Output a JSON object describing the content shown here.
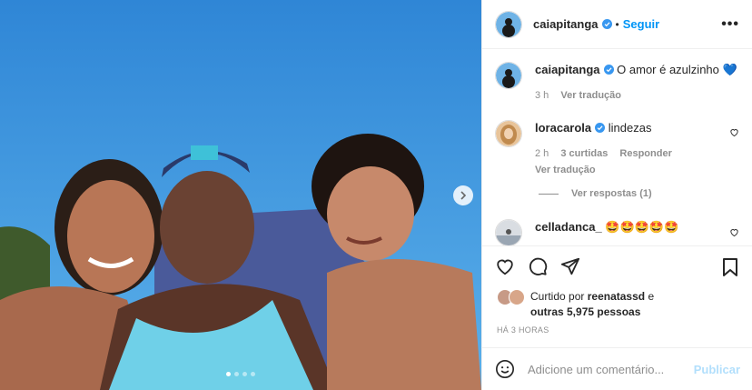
{
  "post": {
    "image_alt": "Selfie de três mulheres na praia",
    "carousel": {
      "slides": 4,
      "active": 0
    }
  },
  "header": {
    "username": "caiapitanga",
    "separator": "•",
    "follow_label": "Seguir",
    "more_icon": "more-horizontal-icon"
  },
  "caption": {
    "username": "caiapitanga",
    "text": "O amor é azulzinho 💙",
    "time": "3 h",
    "translate": "Ver tradução"
  },
  "comments": [
    {
      "username": "loracarola",
      "text": "lindezas",
      "time": "2 h",
      "likes": "3 curtidas",
      "reply": "Responder",
      "translate": "Ver tradução",
      "replies": "Ver respostas (1)"
    },
    {
      "username": "celladanca_",
      "text": "🤩🤩🤩🤩🤩"
    }
  ],
  "likes": {
    "prefix": "Curtido por",
    "user": "reenatassd",
    "suffix": "e",
    "others": "outras 5,975 pessoas"
  },
  "timestamp": "HÁ 3 HORAS",
  "add_comment": {
    "placeholder": "Adicione um comentário...",
    "publish_label": "Publicar"
  },
  "colors": {
    "accent": "#0095f6",
    "verified": "#3897f0",
    "sky": "#2d8ad8"
  }
}
